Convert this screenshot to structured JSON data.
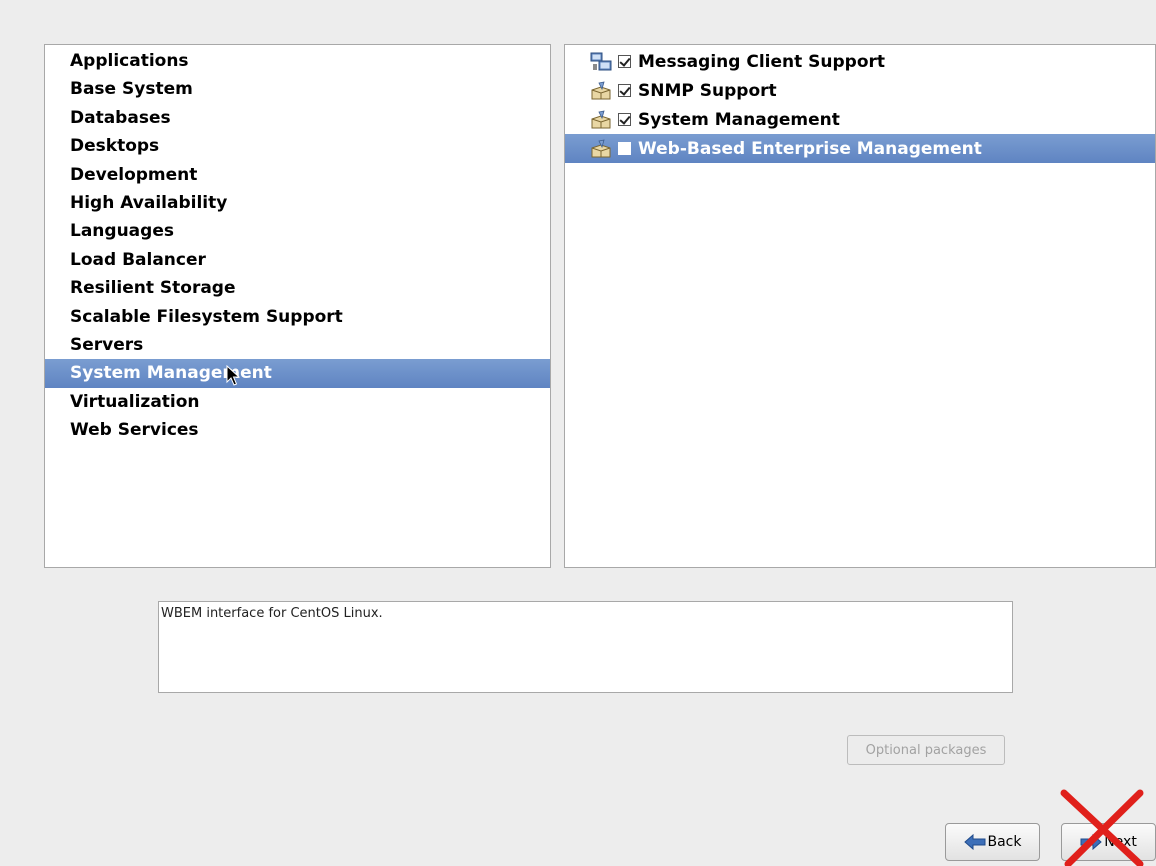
{
  "categories": {
    "items": [
      {
        "label": "Applications"
      },
      {
        "label": "Base System"
      },
      {
        "label": "Databases"
      },
      {
        "label": "Desktops"
      },
      {
        "label": "Development"
      },
      {
        "label": "High Availability"
      },
      {
        "label": "Languages"
      },
      {
        "label": "Load Balancer"
      },
      {
        "label": "Resilient Storage"
      },
      {
        "label": "Scalable Filesystem Support"
      },
      {
        "label": "Servers"
      },
      {
        "label": "System Management"
      },
      {
        "label": "Virtualization"
      },
      {
        "label": "Web Services"
      }
    ],
    "selected": "System Management"
  },
  "groups": {
    "items": [
      {
        "label": "Messaging Client Support",
        "checked": true,
        "icon": "messaging-icon"
      },
      {
        "label": "SNMP Support",
        "checked": true,
        "icon": "package-group-icon"
      },
      {
        "label": "System Management",
        "checked": true,
        "icon": "package-group-icon"
      },
      {
        "label": "Web-Based Enterprise Management",
        "checked": false,
        "icon": "package-group-icon"
      }
    ],
    "selected": "Web-Based Enterprise Management"
  },
  "description": {
    "text": "WBEM interface for CentOS Linux."
  },
  "buttons": {
    "optional_packages": "Optional packages",
    "back": "Back",
    "next": "Next"
  },
  "colors": {
    "selection": "#6b8fc9",
    "background": "#ededed",
    "overlay_x": "#e0201b"
  }
}
